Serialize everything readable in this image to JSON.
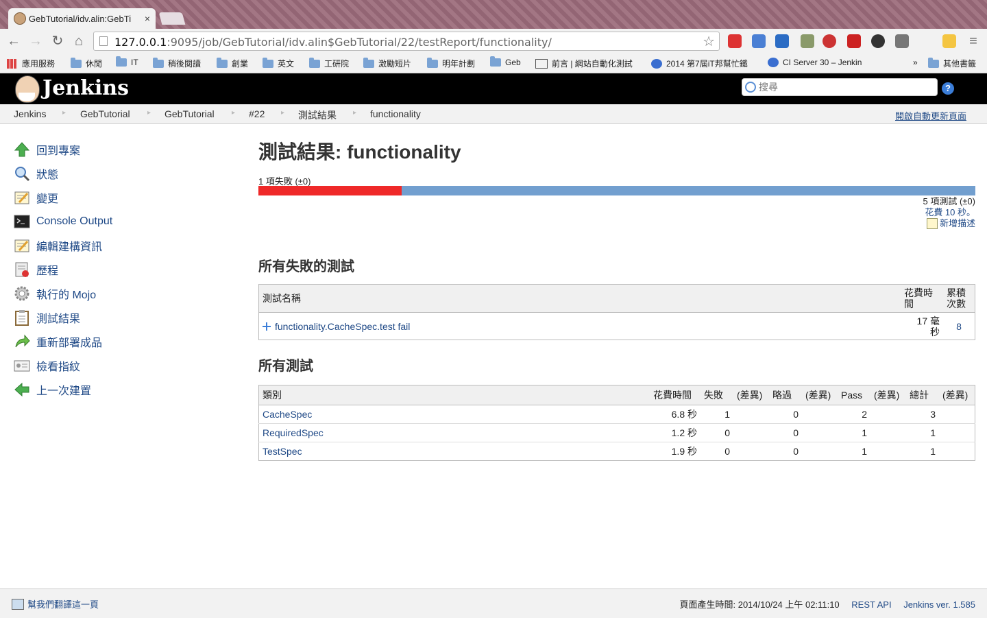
{
  "browser": {
    "tab_title": "GebTutorial/idv.alin:GebTi",
    "tab_close": "×",
    "url_host": "127.0.0.1",
    "url_rest": ":9095/job/GebTutorial/idv.alin$GebTutorial/22/testReport/functionality/",
    "bookmarks": [
      "應用服務",
      "休閒",
      "IT",
      "稍後閱讀",
      "創業",
      "英文",
      "工研院",
      "激勵短片",
      "明年計劃",
      "Geb",
      "前言 | 網站自動化測試",
      "2014 第7屆iT邦幫忙鐵",
      "CI Server 30 – Jenkin",
      "»",
      "其他書籤"
    ]
  },
  "header": {
    "title": "Jenkins",
    "search_placeholder": "搜尋",
    "help": "?"
  },
  "breadcrumb": {
    "items": [
      "Jenkins",
      "GebTutorial",
      "GebTutorial",
      "#22",
      "測試結果",
      "functionality"
    ],
    "autorefresh": "開啟自動更新頁面"
  },
  "sidebar": {
    "items": [
      "回到專案",
      "狀態",
      "變更",
      "Console Output",
      "編輯建構資訊",
      "歷程",
      "執行的 Mojo",
      "測試結果",
      "重新部署成品",
      "檢看指紋",
      "上一次建置"
    ]
  },
  "main": {
    "title": "測試結果: functionality",
    "fail_summary": "1 項失敗 (±0)",
    "fail_fraction": 0.2,
    "total_summary": "5 項測試 (±0)",
    "duration_link": "花費 10 秒。",
    "add_description": "新增描述",
    "failed_heading": "所有失敗的測試",
    "failed_table": {
      "headers": [
        "測試名稱",
        "花費時\n間",
        "累積\n次數"
      ],
      "rows": [
        {
          "name": "functionality.CacheSpec.test fail",
          "duration": "17 毫\n秒",
          "age": "8"
        }
      ]
    },
    "all_heading": "所有測試",
    "all_table": {
      "headers": [
        "類別",
        "花費時間",
        "失敗",
        "(差異)",
        "略過",
        "(差異)",
        "Pass",
        "(差異)",
        "總計",
        "(差異)"
      ],
      "rows": [
        {
          "name": "CacheSpec",
          "duration": "6.8 秒",
          "fail": "1",
          "skip": "0",
          "pass": "2",
          "total": "3"
        },
        {
          "name": "RequiredSpec",
          "duration": "1.2 秒",
          "fail": "0",
          "skip": "0",
          "pass": "1",
          "total": "1"
        },
        {
          "name": "TestSpec",
          "duration": "1.9 秒",
          "fail": "0",
          "skip": "0",
          "pass": "1",
          "total": "1"
        }
      ]
    }
  },
  "footer": {
    "translate": "幫我們翻譯這一頁",
    "generated": "頁面產生時間: 2014/10/24 上午 02:11:10",
    "rest_api": "REST API",
    "version": "Jenkins ver. 1.585"
  }
}
